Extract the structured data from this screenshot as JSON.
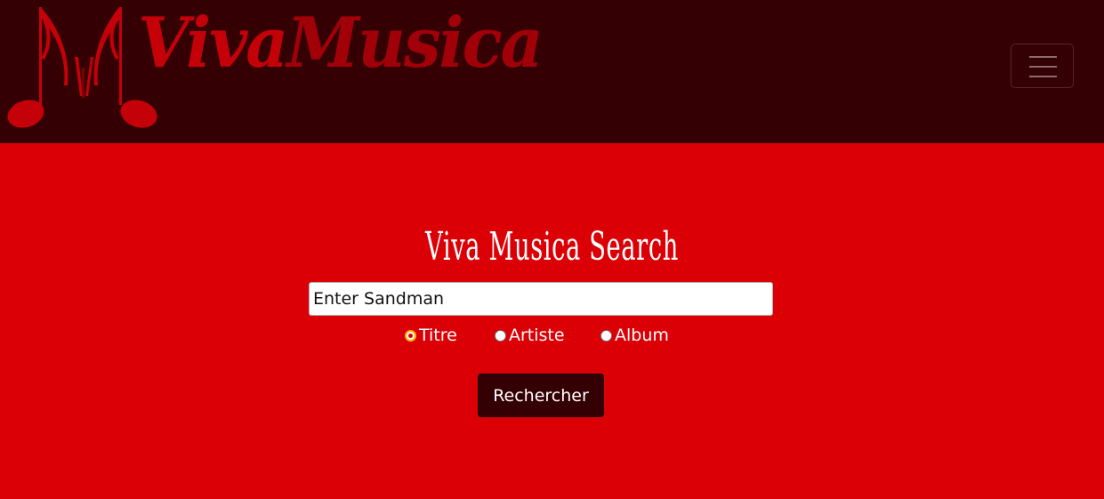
{
  "header": {
    "brand_part1": "Viva",
    "brand_part2": "Musica",
    "logo_icon": "music-notes-logo-icon",
    "menu_icon": "hamburger-menu-icon",
    "colors": {
      "navbar_bg": "#350004",
      "brand_red": "#c40009",
      "brand_dark_red": "#a20008"
    }
  },
  "search": {
    "title": "Viva Musica Search",
    "input_value": "Enter Sandman",
    "options": [
      {
        "label": "Titre",
        "checked": true
      },
      {
        "label": "Artiste",
        "checked": false
      },
      {
        "label": "Album",
        "checked": false
      }
    ],
    "button_label": "Rechercher",
    "colors": {
      "page_bg": "#db0006",
      "button_bg": "#350004"
    }
  }
}
